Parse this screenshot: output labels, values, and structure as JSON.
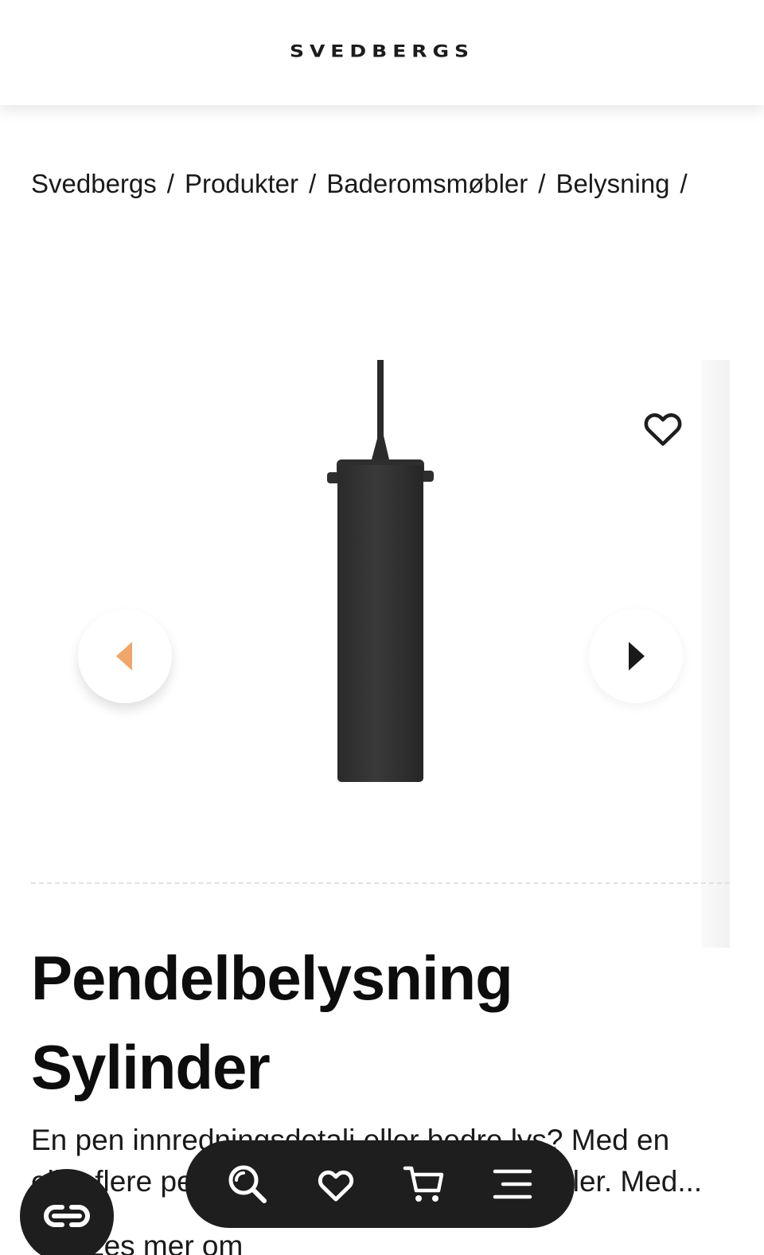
{
  "header": {
    "logo": "SVEDBERGS"
  },
  "breadcrumb": {
    "items": [
      "Svedbergs",
      "Produkter",
      "Baderomsmøbler",
      "Belysning"
    ],
    "separator": "/"
  },
  "gallery": {
    "image_icon": "pendant-lamp-image",
    "favorite_icon": "heart-outline-icon",
    "prev_icon": "chevron-left-icon",
    "next_icon": "chevron-right-icon",
    "prev_color": "#f0a56b"
  },
  "product": {
    "title_line1": "Pendelbelysning",
    "title_line2": "Sylinder",
    "description_line1": "En pen innredningsdetalj eller bedre lys? Med en",
    "description_line2": "eller flere pendellamper over servanten eller. Med...",
    "read_more": "Les mer om"
  },
  "bottom_nav": {
    "items": [
      {
        "icon": "search-icon"
      },
      {
        "icon": "heart-icon"
      },
      {
        "icon": "cart-icon"
      },
      {
        "icon": "menu-icon"
      }
    ]
  },
  "chat": {
    "icon": "chat-logo-icon"
  }
}
